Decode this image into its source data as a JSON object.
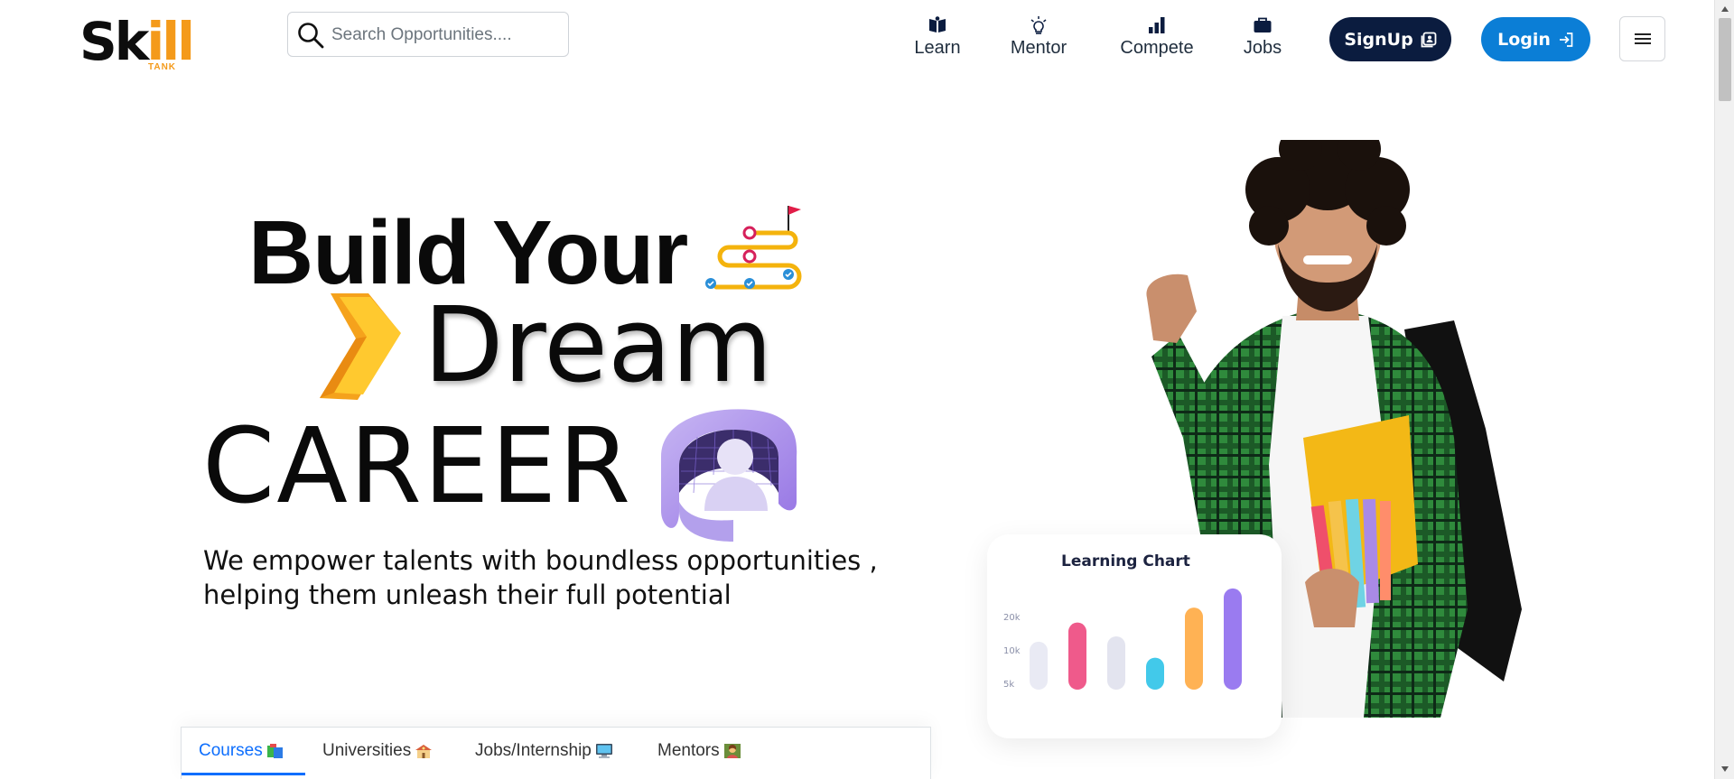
{
  "logo": {
    "word_start": "Sk",
    "word_accent": "ill",
    "sub": "TANK"
  },
  "search": {
    "placeholder": "Search Opportunities...."
  },
  "nav": {
    "items": [
      {
        "label": "Learn",
        "icon": "book-icon"
      },
      {
        "label": "Mentor",
        "icon": "bulb-icon"
      },
      {
        "label": "Compete",
        "icon": "bar-chart-icon"
      },
      {
        "label": "Jobs",
        "icon": "briefcase-icon"
      }
    ],
    "signup_label": "SignUp",
    "login_label": "Login"
  },
  "hero": {
    "line1": "Build Your",
    "line2": "Dream",
    "line3": "CAREER",
    "subtitle": "We empower talents with boundless opportunities , helping them unleash their full potential"
  },
  "chart_card": {
    "title": "Learning Chart",
    "chart_data": {
      "type": "bar",
      "title": "Learning Chart",
      "y_ticks": [
        "20k",
        "10k",
        "5k"
      ],
      "values": [
        0.45,
        0.63,
        0.5,
        0.3,
        0.77,
        0.95
      ],
      "colors": [
        "#e9eaf4",
        "#ef5a8b",
        "#e3e4ef",
        "#42c9ea",
        "#ffb254",
        "#9a7bf0"
      ]
    }
  },
  "tabs": [
    {
      "label": "Courses",
      "active": true
    },
    {
      "label": "Universities",
      "active": false
    },
    {
      "label": "Jobs/Internship",
      "active": false
    },
    {
      "label": "Mentors",
      "active": false
    }
  ],
  "colors": {
    "brand_orange": "#f49a1a",
    "signup_bg": "#0b1c3f",
    "login_bg": "#0b7ed6",
    "active_tab": "#0d6efd"
  }
}
